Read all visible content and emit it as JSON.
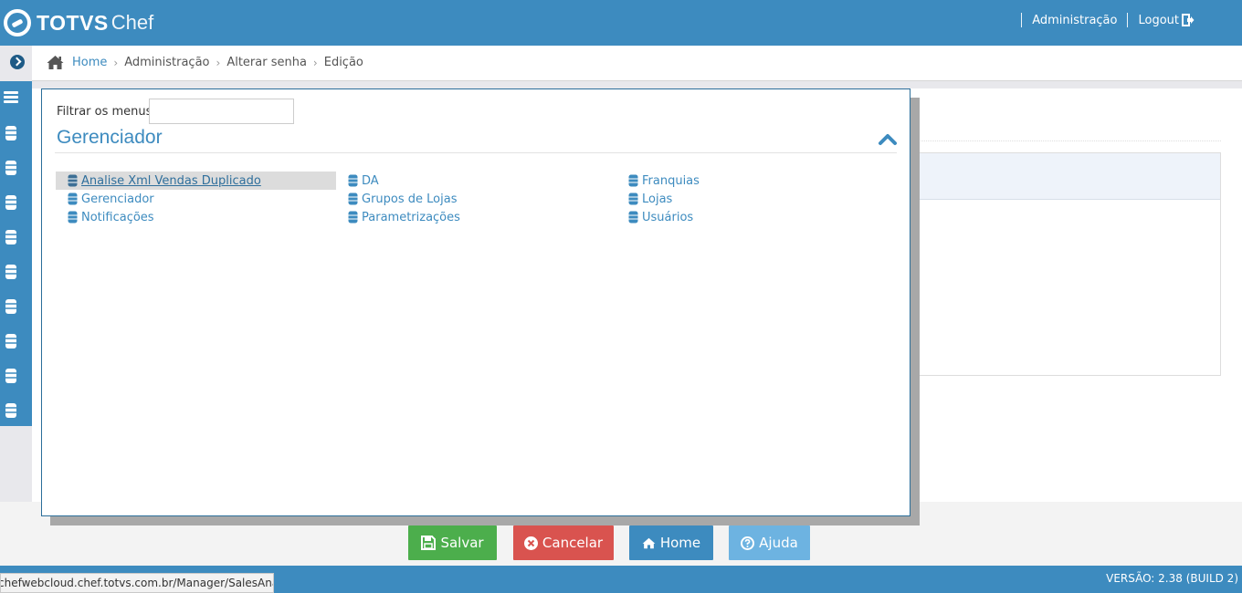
{
  "header": {
    "brand": "TOTVS",
    "brand_suffix": "Chef",
    "nav": {
      "admin": "Administração",
      "logout": "Logout"
    }
  },
  "breadcrumb": {
    "home": "Home",
    "items": [
      "Administração",
      "Alterar senha",
      "Edição"
    ],
    "separator": "›"
  },
  "menu_modal": {
    "filter_label": "Filtrar os menus",
    "filter_value": "",
    "section_title": "Gerenciador",
    "columns": [
      [
        {
          "label": "Analise Xml Vendas Duplicado",
          "active": true
        },
        {
          "label": "Gerenciador",
          "active": false
        },
        {
          "label": "Notificações",
          "active": false
        }
      ],
      [
        {
          "label": "DA",
          "active": false
        },
        {
          "label": "Grupos de Lojas",
          "active": false
        },
        {
          "label": "Parametrizações",
          "active": false
        }
      ],
      [
        {
          "label": "Franquias",
          "active": false
        },
        {
          "label": "Lojas",
          "active": false
        },
        {
          "label": "Usuários",
          "active": false
        }
      ]
    ]
  },
  "buttons": {
    "save": "Salvar",
    "cancel": "Cancelar",
    "home": "Home",
    "help": "Ajuda"
  },
  "status": {
    "url": "chefwebcloud.chef.totvs.com.br/Manager/SalesAnalytics",
    "version": "VERSÃO: 2.38 (BUILD 2)"
  },
  "colors": {
    "primary": "#3d8bbf",
    "save": "#4cae4c",
    "cancel": "#d9534f",
    "help": "#6db3e1"
  },
  "icons": {
    "menu_item": "database-icon",
    "sidebar": "database-icon",
    "collapse": "chevron-up-icon"
  }
}
